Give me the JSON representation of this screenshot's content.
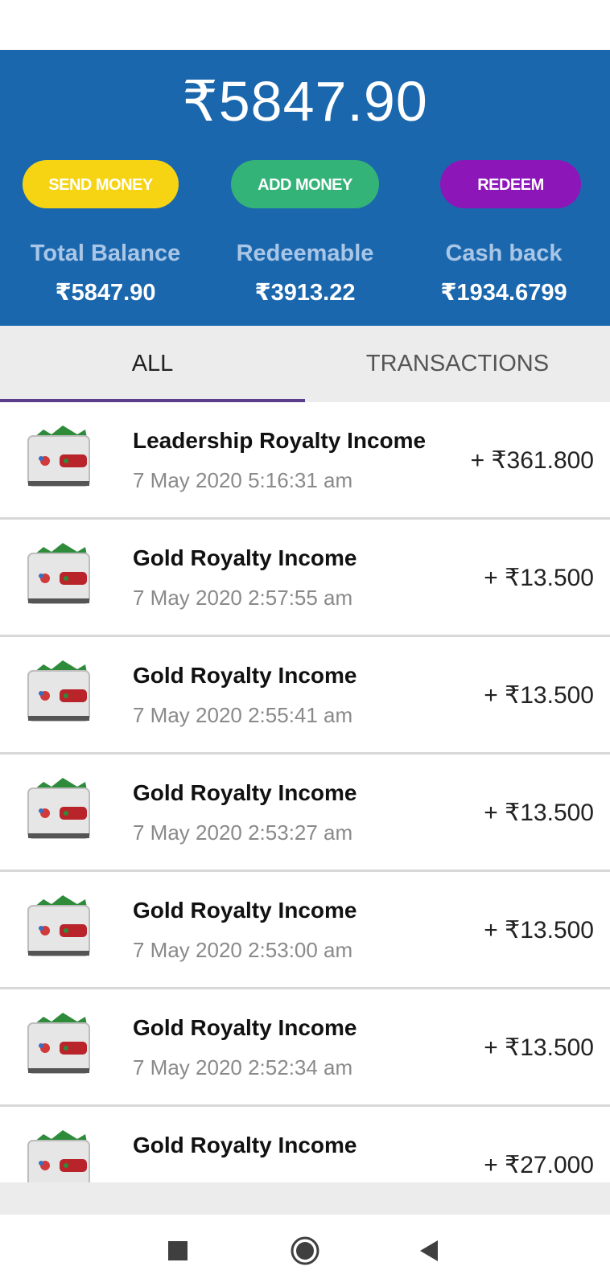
{
  "wallet": {
    "main_balance": "₹5847.90",
    "buttons": {
      "send": "SEND MONEY",
      "add": "ADD MONEY",
      "redeem": "REDEEM"
    },
    "stats": [
      {
        "label": "Total Balance",
        "value": "₹5847.90"
      },
      {
        "label": "Redeemable",
        "value": "₹3913.22"
      },
      {
        "label": "Cash back",
        "value": "₹1934.6799"
      }
    ],
    "colors": {
      "header": "#1b67ad",
      "send": "#f6d414",
      "add": "#34b378",
      "redeem": "#8d16b9",
      "tab_indicator": "#5b3e8a"
    }
  },
  "tabs": [
    {
      "label": "ALL",
      "selected": true
    },
    {
      "label": "TRANSACTIONS",
      "selected": false
    }
  ],
  "transactions": [
    {
      "icon": "wallet-icon",
      "title": "Leadership Royalty Income",
      "date": "7 May 2020 5:16:31 am",
      "amount": "+ ₹361.800"
    },
    {
      "icon": "wallet-icon",
      "title": "Gold Royalty Income",
      "date": "7 May 2020 2:57:55 am",
      "amount": "+ ₹13.500"
    },
    {
      "icon": "wallet-icon",
      "title": "Gold Royalty Income",
      "date": "7 May 2020 2:55:41 am",
      "amount": "+ ₹13.500"
    },
    {
      "icon": "wallet-icon",
      "title": "Gold Royalty Income",
      "date": "7 May 2020 2:53:27 am",
      "amount": "+ ₹13.500"
    },
    {
      "icon": "wallet-icon",
      "title": "Gold Royalty Income",
      "date": "7 May 2020 2:53:00 am",
      "amount": "+ ₹13.500"
    },
    {
      "icon": "wallet-icon",
      "title": "Gold Royalty Income",
      "date": "7 May 2020 2:52:34 am",
      "amount": "+ ₹13.500"
    },
    {
      "icon": "wallet-icon",
      "title": "Gold Royalty Income",
      "date": "",
      "amount": "+ ₹27.000"
    }
  ],
  "system_nav": {
    "icons": [
      "recent-apps-icon",
      "home-icon",
      "back-icon"
    ]
  }
}
